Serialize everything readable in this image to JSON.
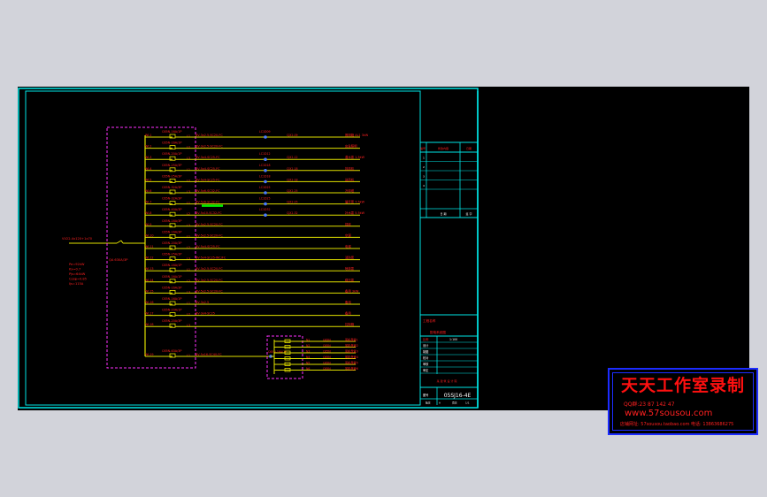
{
  "colors": {
    "frame": "#00e5e5",
    "label": "#ff2020",
    "bus": "#e0e000",
    "enclosure": "#ff30ff",
    "breaker": "#e8e000",
    "contact": "#4a7cff",
    "highlight": "#00ee00",
    "watermark_border": "#1c2cff",
    "background": "#000000",
    "surround": "#d2d3da"
  },
  "incoming": {
    "cable_label": "VV22-4x120+1x70",
    "switch_label": "QA 630A/3P",
    "specs": [
      "Pe=92kW",
      "Kx=0.7",
      "Pjs=64kW",
      "Cosφ=0.85",
      "Ijs=115A"
    ]
  },
  "circuits": [
    {
      "id": "WL1",
      "breaker": "C65N-16A/1P",
      "cable": "BV-3x2.5-SC20-FC",
      "contactor": "LC1D09",
      "contactor_rating": "CJX2-09",
      "load": "照明箱 AL1 3kW"
    },
    {
      "id": "WL2",
      "breaker": "C65N-16A/1P",
      "cable": "BV-3x2.5-SC20-FC",
      "contactor": "",
      "contactor_rating": "",
      "load": "应急照明"
    },
    {
      "id": "WL3",
      "breaker": "C65N-20A/1P",
      "cable": "BV-3x4-SC25-FC",
      "contactor": "LC1D12",
      "contactor_rating": "CJX2-12",
      "load": "潜水泵 1.5kW"
    },
    {
      "id": "WL4",
      "breaker": "C65N-25A/3P",
      "cable": "BV-5x4-SC25-FC",
      "contactor": "LC1D18",
      "contactor_rating": "CJX2-18",
      "load": "排风机"
    },
    {
      "id": "WL5",
      "breaker": "C65N-25A/3P",
      "cable": "BV-5x4-SC25-FC",
      "contactor": "LC1D18",
      "contactor_rating": "CJX2-18",
      "load": "送风机"
    },
    {
      "id": "WL6",
      "breaker": "C65N-32A/3P",
      "cable": "BV-5x6-SC32-FC",
      "contactor": "LC1D25",
      "contactor_rating": "CJX2-25",
      "load": "冷却塔"
    },
    {
      "id": "WL7",
      "breaker": "C65N-32A/3P",
      "cable": "BV-5x6-SC32-FC",
      "contactor": "LC1D25",
      "contactor_rating": "CJX2-25",
      "load": "循环泵 7.5kW"
    },
    {
      "id": "WL8",
      "breaker": "C65N-40A/3P",
      "cable": "BV-5x10-SC32-FC",
      "contactor": "LC1D32",
      "contactor_rating": "CJX2-32",
      "load": "补水泵 5.5kW"
    },
    {
      "id": "WL9",
      "breaker": "C65N-16A/3P",
      "cable": "BV-5x2.5-SC20-FC",
      "contactor": "",
      "contactor_rating": "",
      "load": "插座"
    },
    {
      "id": "WL10",
      "breaker": "C65N-16A/3P",
      "cable": "BV-5x2.5-SC20-FC",
      "contactor": "",
      "contactor_rating": "",
      "load": "空调"
    },
    {
      "id": "WL11",
      "breaker": "C65N-20A/3P",
      "cable": "BV-5x4-SC25-FC",
      "contactor": "",
      "contactor_rating": "",
      "load": "电梯"
    },
    {
      "id": "WL12",
      "breaker": "C65N-25A/3P",
      "cable": "BV-5x4-SC25-WC/FC",
      "contactor": "",
      "contactor_rating": "",
      "load": "消防泵"
    },
    {
      "id": "WL13",
      "breaker": "C65N-16A/1P",
      "cable": "BV-3x2.5-SC20-FC",
      "contactor": "",
      "contactor_rating": "",
      "load": "喷淋泵"
    },
    {
      "id": "WL14",
      "breaker": "C65N-16A/1P",
      "cable": "BV-3x2.5-SC20-FC",
      "contactor": "",
      "contactor_rating": "",
      "load": "稳压泵"
    },
    {
      "id": "WL15",
      "breaker": "C65N-16A/3P",
      "cable": "BV-5x2.5-SC20-FC",
      "contactor": "",
      "contactor_rating": "",
      "load": "备用 3kW"
    },
    {
      "id": "WL16",
      "breaker": "C65N-16A/1P",
      "cable": "BV-3x2.5",
      "contactor": "",
      "contactor_rating": "",
      "load": "备用"
    },
    {
      "id": "WL17",
      "breaker": "C65N-20A/1P",
      "cable": "BV-3x4-SC25",
      "contactor": "",
      "contactor_rating": "",
      "load": "备用"
    },
    {
      "id": "WL18",
      "breaker": "C65N-20A/3P",
      "cable": "",
      "contactor": "",
      "contactor_rating": "",
      "load": "控制箱"
    },
    {
      "id": "WL19",
      "breaker": "C65N-63A/3P",
      "cable": "BV-5x16-SC40-FC",
      "contactor": "",
      "contactor_rating": "",
      "load": ""
    }
  ],
  "subfeeders": [
    {
      "id": "N1",
      "breaker": "C65N",
      "load": "风机盘管1"
    },
    {
      "id": "N2",
      "breaker": "C65N",
      "load": "风机盘管2"
    },
    {
      "id": "N3",
      "breaker": "C65N",
      "load": "风机盘管3"
    },
    {
      "id": "N4",
      "breaker": "C65N",
      "load": "风机盘管4"
    },
    {
      "id": "N5",
      "breaker": "C65N",
      "load": "风机盘管5"
    },
    {
      "id": "N6",
      "breaker": "C65N",
      "load": "风机盘管6"
    }
  ],
  "subfeeder_header": "C65N-16A/1P",
  "title_block": {
    "rev_header": [
      "编号",
      "修改内容",
      "日期"
    ],
    "rev_rows": [
      "1",
      "2",
      "3",
      "4"
    ],
    "rev_bottom": [
      "日 期",
      "签 字"
    ],
    "project_label": "工程名称",
    "drawing_label": "配电系统图",
    "scale_label": "比例",
    "scale_value": "1:100",
    "rows": [
      "设计",
      "制图",
      "校对",
      "审核",
      "审定"
    ],
    "company": "某 建 筑 设 计 院",
    "drawing_no_label": "图号",
    "drawing_no": "05SJ16-4E",
    "footer": [
      "版次",
      "A",
      "页次",
      "1/1"
    ]
  },
  "watermark": {
    "title": "天天工作室录制",
    "qq": "QQ群:23 87 142 47",
    "url": "www.57sousou.com",
    "tel": "店铺网址: 57sousou.taobao.com  电话: 13863686275"
  }
}
